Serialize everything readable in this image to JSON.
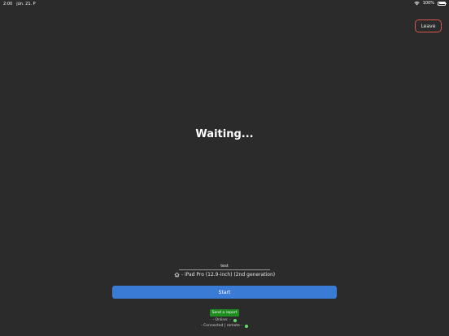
{
  "status_bar": {
    "time": "2:00",
    "date": "jún. 21. P",
    "battery": "100%"
  },
  "header": {
    "leave_label": "Leave"
  },
  "main": {
    "title": "Waiting..."
  },
  "form": {
    "name_value": "test",
    "device_text": "- iPad Pro (12.9-inch) (2nd generation)",
    "start_label": "Start"
  },
  "footer": {
    "report_label": "Send a report",
    "online_text": "- Online: -",
    "connected_text": "- Connected | remote -"
  },
  "colors": {
    "background": "#2b2b2b",
    "accent": "#3a7bd5",
    "leave_border": "#d9534f",
    "report": "#1e8c1e",
    "status_ok": "#5ee06a"
  },
  "icons": {
    "wifi": "wifi-icon",
    "battery": "battery-icon",
    "home": "home-icon"
  }
}
